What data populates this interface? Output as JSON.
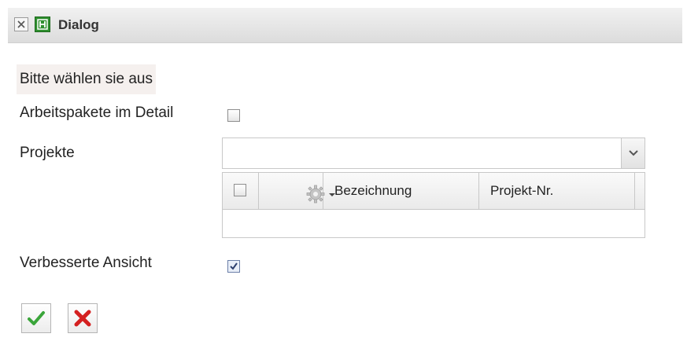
{
  "dialog": {
    "title": "Dialog",
    "close_icon": "close-icon",
    "app_icon": "app-icon"
  },
  "form": {
    "prompt": "Bitte wählen sie aus",
    "arbeitspakete": {
      "label": "Arbeitspakete im Detail",
      "checked": false
    },
    "projekte": {
      "label": "Projekte",
      "combo_value": "",
      "grid": {
        "columns": [
          "Bezeichnung",
          "Projekt-Nr."
        ],
        "settings_icon": "gear-icon",
        "rows": []
      }
    },
    "verbesserte": {
      "label": "Verbesserte Ansicht",
      "checked": true
    }
  },
  "actions": {
    "ok_icon": "checkmark-icon",
    "cancel_icon": "cross-icon"
  },
  "colors": {
    "ok_green": "#3aa53a",
    "cancel_red": "#d42020",
    "app_icon_green": "#2f8f2f"
  }
}
